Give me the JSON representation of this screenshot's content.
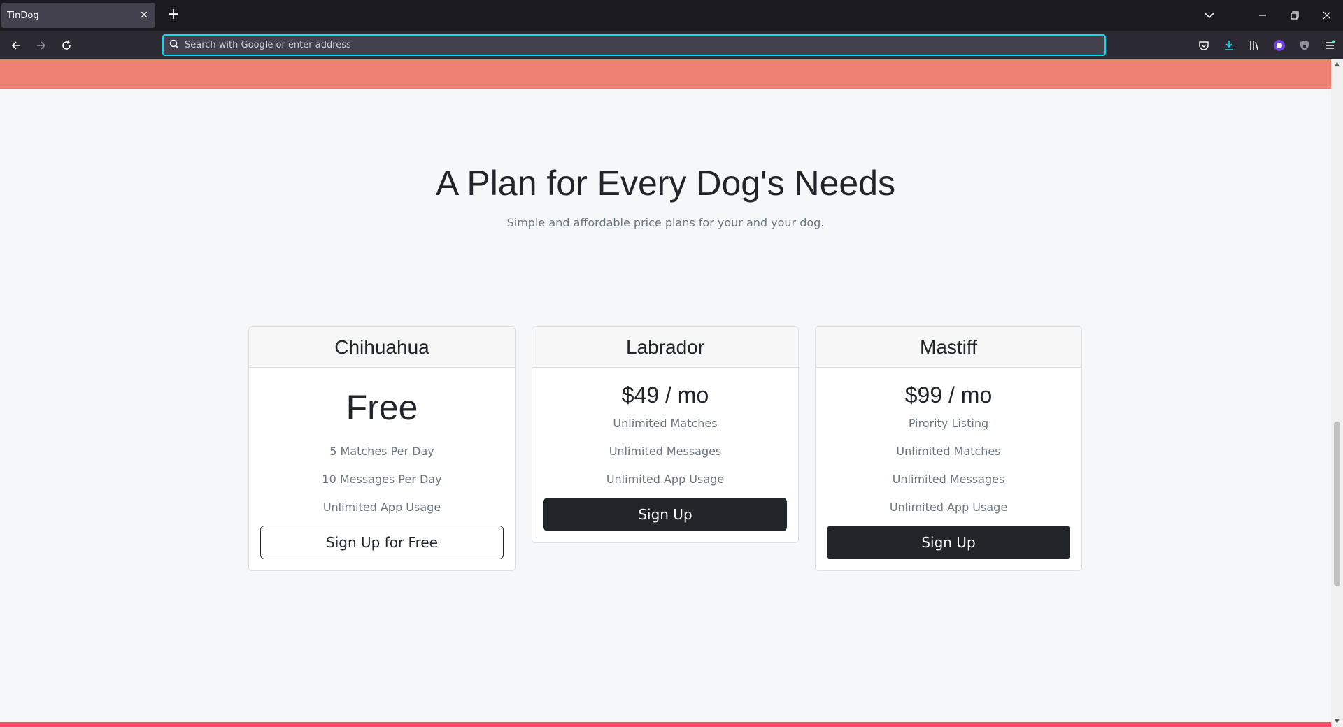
{
  "browser": {
    "tab_title": "TinDog",
    "tab_close": "✕",
    "new_tab": "+",
    "url_placeholder": "Search with Google or enter address"
  },
  "pricing": {
    "title": "A Plan for Every Dog's Needs",
    "subtitle": "Simple and affordable price plans for your and your dog.",
    "plans": [
      {
        "name": "Chihuahua",
        "price": "Free",
        "features": [
          "5 Matches Per Day",
          "10 Messages Per Day",
          "Unlimited App Usage"
        ],
        "button": "Sign Up for Free"
      },
      {
        "name": "Labrador",
        "price": "$49 / mo",
        "features": [
          "Unlimited Matches",
          "Unlimited Messages",
          "Unlimited App Usage"
        ],
        "button": "Sign Up"
      },
      {
        "name": "Mastiff",
        "price": "$99 / mo",
        "features": [
          "Pirority Listing",
          "Unlimited Matches",
          "Unlimited Messages",
          "Unlimited App Usage"
        ],
        "button": "Sign Up"
      }
    ]
  },
  "colors": {
    "accent_top": "#ef8172",
    "accent_bottom": "#ff4c68",
    "dark": "#212529",
    "url_focus": "#00ddff"
  },
  "icons": {
    "back": "arrow-left-icon",
    "forward": "arrow-right-icon",
    "reload": "reload-icon",
    "search": "search-icon",
    "pocket": "pocket-icon",
    "download": "download-icon",
    "library": "library-icon",
    "extension_profile": "extension-icon",
    "shield": "shield-icon",
    "menu": "hamburger-menu-icon",
    "list_tabs": "chevron-down-icon",
    "minimize": "minimize-icon",
    "restore": "restore-icon",
    "close": "close-icon"
  }
}
